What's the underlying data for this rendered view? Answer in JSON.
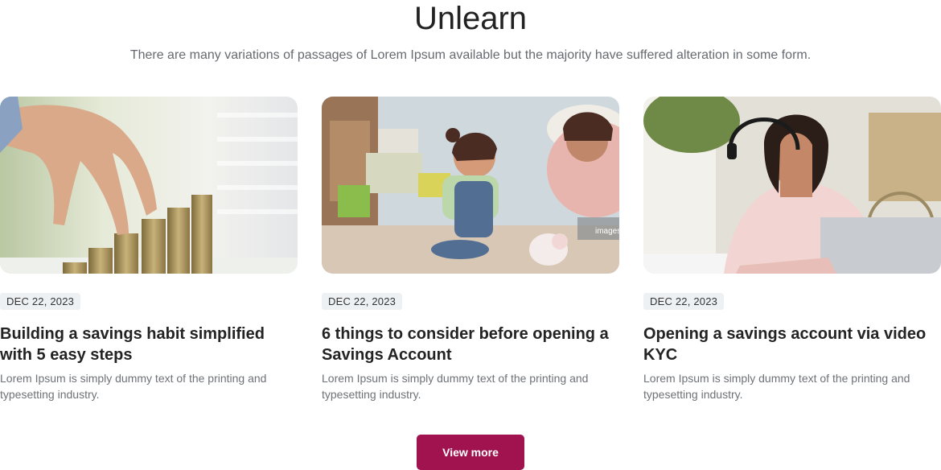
{
  "section": {
    "title": "Unlearn",
    "subtitle": "There are many variations of passages of Lorem Ipsum available but the majority have suffered alteration in some form."
  },
  "cards": [
    {
      "image_alt": "hand-stacking-coins",
      "date": "DEC 22, 2023",
      "title": "Building a savings habit simplified with 5 easy steps",
      "description": "Lorem Ipsum is simply dummy text of the printing and typesetting industry."
    },
    {
      "image_alt": "mother-and-child-with-piggy-bank",
      "date": "DEC 22, 2023",
      "title": "6 things to consider before opening a Savings Account",
      "description": "Lorem Ipsum is simply dummy text of the printing and typesetting industry.",
      "watermark": "images"
    },
    {
      "image_alt": "woman-with-headset-at-laptop",
      "date": "DEC 22, 2023",
      "title": "Opening a savings account via video KYC",
      "description": "Lorem Ipsum is simply dummy text of the printing and typesetting industry."
    }
  ],
  "actions": {
    "view_more_label": "View more"
  },
  "colors": {
    "accent": "#a0134f",
    "badge_bg": "#eef1f4",
    "muted_text": "#6e7277"
  }
}
